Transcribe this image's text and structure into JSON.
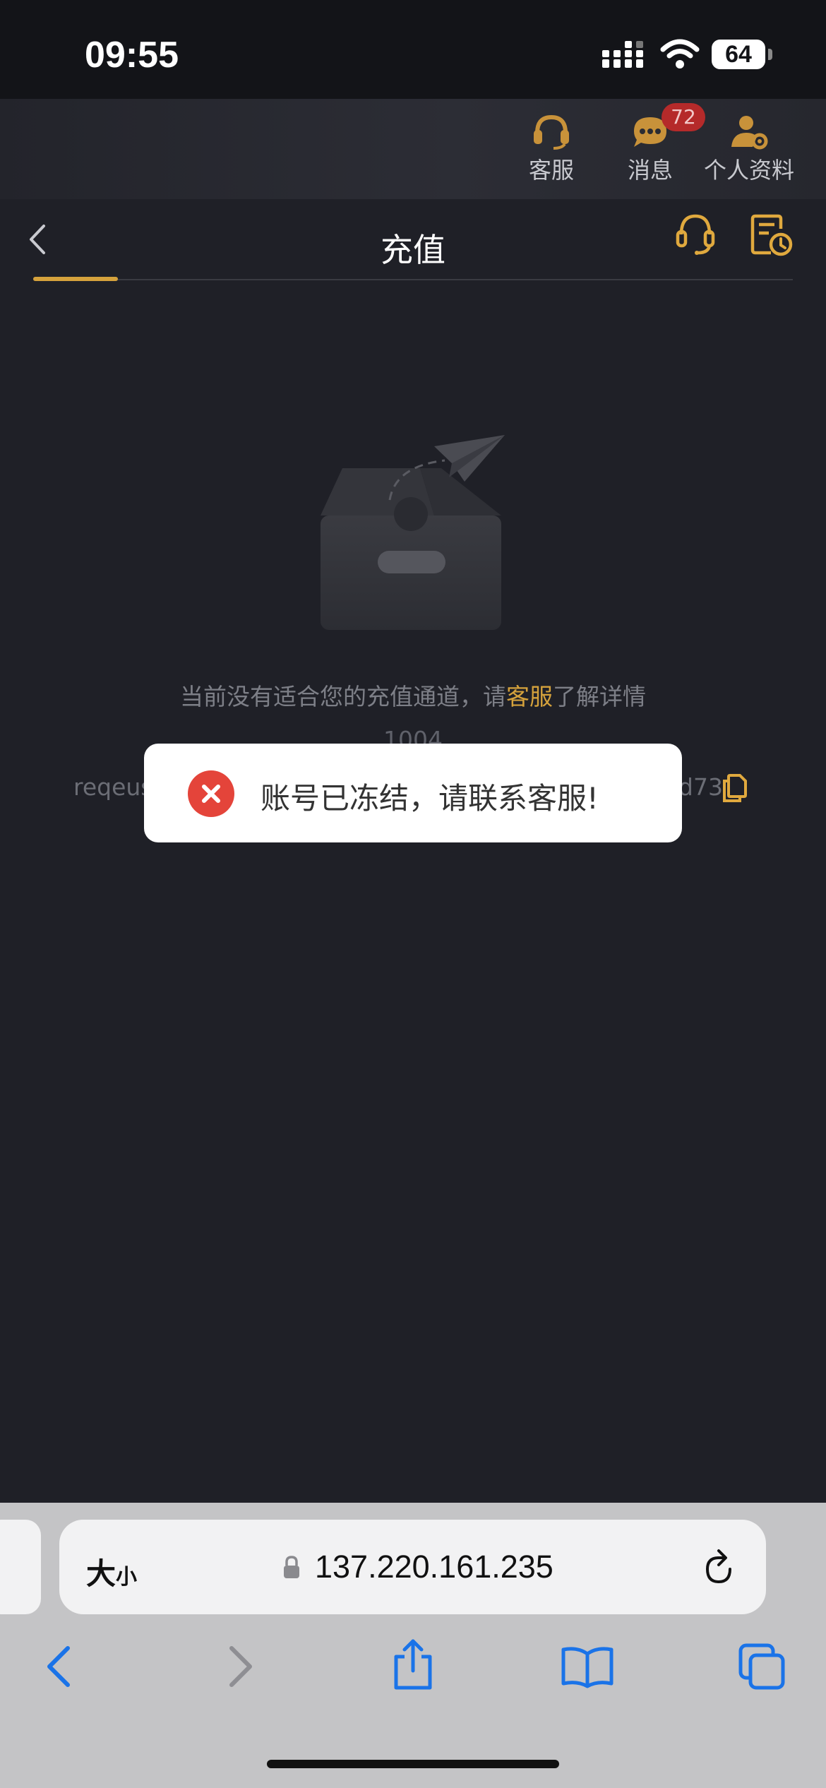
{
  "status_bar": {
    "time": "09:55",
    "battery": "64"
  },
  "top_nav": {
    "items": [
      {
        "label": "客服",
        "icon": "headset-icon"
      },
      {
        "label": "消息",
        "icon": "chat-bubble-icon",
        "badge": "72"
      },
      {
        "label": "个人资料",
        "icon": "user-settings-icon"
      }
    ]
  },
  "header": {
    "title": "充值",
    "back_icon": "chevron-left-icon",
    "right_icons": [
      "headset-icon",
      "record-history-icon"
    ]
  },
  "empty_state": {
    "message_prefix": "当前没有适合您的充值通道，请",
    "message_link": "客服",
    "message_suffix": "了解详情",
    "error_code": "1004",
    "request_label": "reqeus",
    "request_value_tail": "d73"
  },
  "toast": {
    "message": "账号已冻结，请联系客服!"
  },
  "browser": {
    "text_size_big": "大",
    "text_size_small": "小",
    "url": "137.220.161.235"
  },
  "colors": {
    "accent": "#d5a23c",
    "background": "#1f2027",
    "error": "#e4443a",
    "browser_blue": "#1a73e8"
  }
}
